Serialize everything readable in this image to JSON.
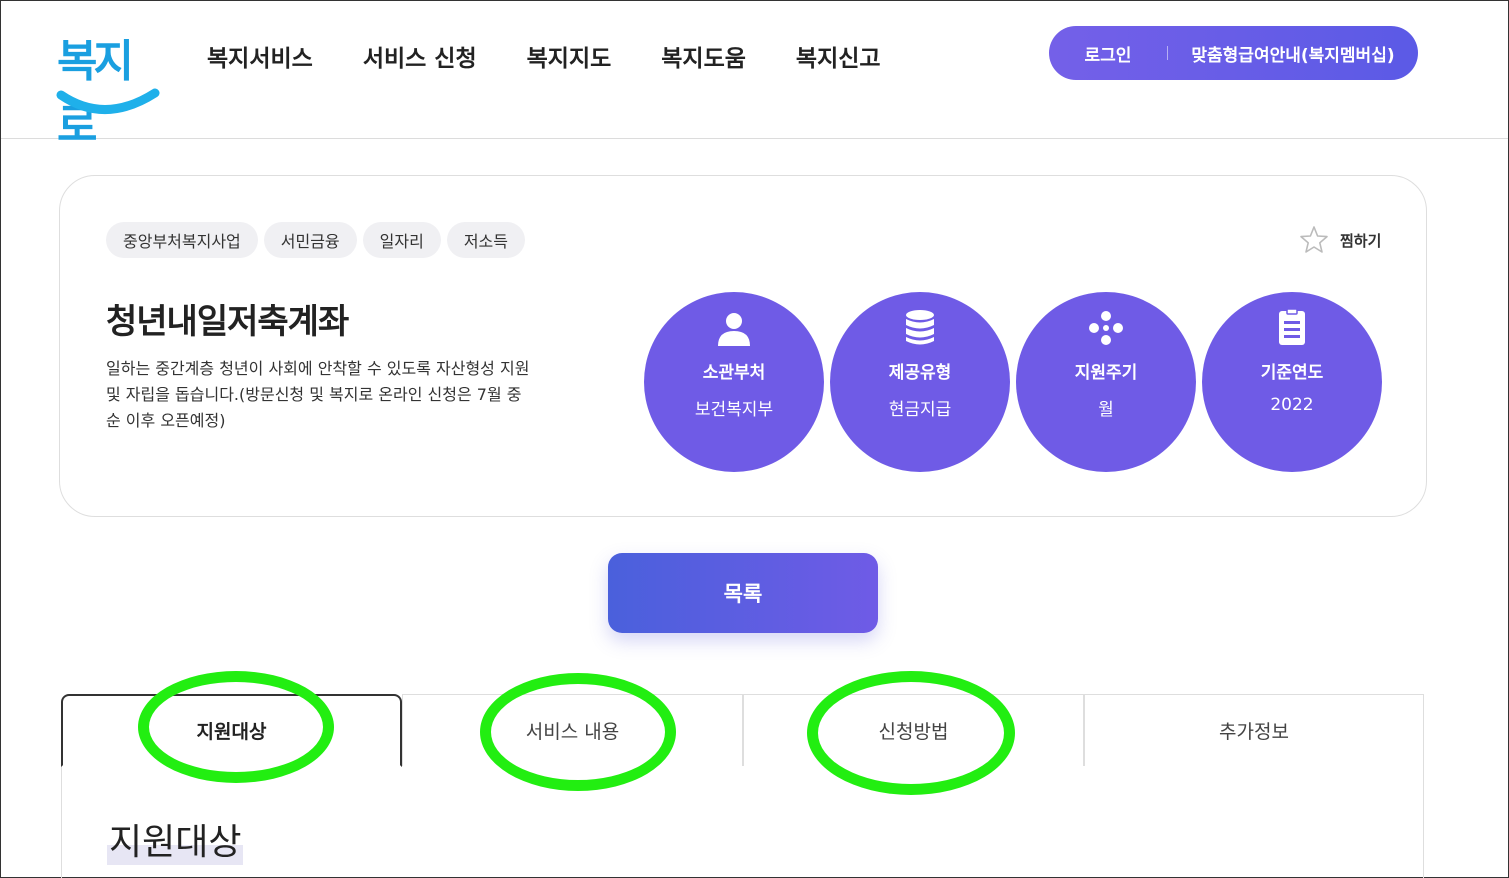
{
  "header": {
    "logo_text": "복지로",
    "nav": [
      "복지서비스",
      "서비스 신청",
      "복지지도",
      "복지도움",
      "복지신고"
    ],
    "login": "로그인",
    "membership": "맞춤형급여안내(복지멤버십)"
  },
  "card": {
    "tags": [
      "중앙부처복지사업",
      "서민금융",
      "일자리",
      "저소득"
    ],
    "favorite": "찜하기",
    "title": "청년내일저축계좌",
    "description": "일하는 중간계층 청년이 사회에 안착할 수 있도록 자산형성 지원 및 자립을 돕습니다.(방문신청 및 복지로 온라인 신청은 7월 중순 이후 오픈예정)",
    "circles": [
      {
        "icon": "person-icon",
        "label": "소관부처",
        "value": "보건복지부"
      },
      {
        "icon": "database-icon",
        "label": "제공유형",
        "value": "현금지급"
      },
      {
        "icon": "dots-icon",
        "label": "지원주기",
        "value": "월"
      },
      {
        "icon": "document-icon",
        "label": "기준연도",
        "value": "2022"
      }
    ],
    "circle_color": "#6f5be6"
  },
  "list_button": "목록",
  "tabs": [
    "지원대상",
    "서비스 내용",
    "신청방법",
    "추가정보"
  ],
  "active_tab": "지원대상",
  "section_title": "지원대상",
  "annotation_color": "#22ee11"
}
